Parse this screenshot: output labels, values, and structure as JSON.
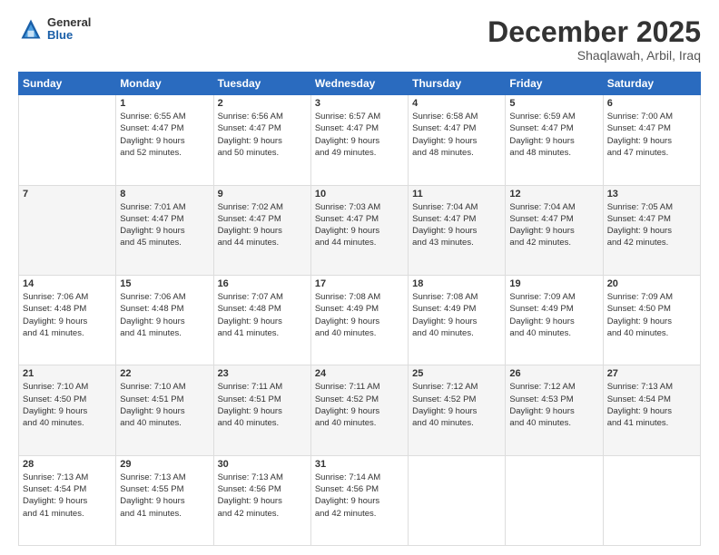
{
  "header": {
    "logo_general": "General",
    "logo_blue": "Blue",
    "month": "December 2025",
    "location": "Shaqlawah, Arbil, Iraq"
  },
  "days_of_week": [
    "Sunday",
    "Monday",
    "Tuesday",
    "Wednesday",
    "Thursday",
    "Friday",
    "Saturday"
  ],
  "weeks": [
    [
      {
        "day": "",
        "info": ""
      },
      {
        "day": "1",
        "info": "Sunrise: 6:55 AM\nSunset: 4:47 PM\nDaylight: 9 hours\nand 52 minutes."
      },
      {
        "day": "2",
        "info": "Sunrise: 6:56 AM\nSunset: 4:47 PM\nDaylight: 9 hours\nand 50 minutes."
      },
      {
        "day": "3",
        "info": "Sunrise: 6:57 AM\nSunset: 4:47 PM\nDaylight: 9 hours\nand 49 minutes."
      },
      {
        "day": "4",
        "info": "Sunrise: 6:58 AM\nSunset: 4:47 PM\nDaylight: 9 hours\nand 48 minutes."
      },
      {
        "day": "5",
        "info": "Sunrise: 6:59 AM\nSunset: 4:47 PM\nDaylight: 9 hours\nand 48 minutes."
      },
      {
        "day": "6",
        "info": "Sunrise: 7:00 AM\nSunset: 4:47 PM\nDaylight: 9 hours\nand 47 minutes."
      }
    ],
    [
      {
        "day": "7",
        "info": ""
      },
      {
        "day": "8",
        "info": "Sunrise: 7:01 AM\nSunset: 4:47 PM\nDaylight: 9 hours\nand 45 minutes."
      },
      {
        "day": "9",
        "info": "Sunrise: 7:02 AM\nSunset: 4:47 PM\nDaylight: 9 hours\nand 44 minutes."
      },
      {
        "day": "10",
        "info": "Sunrise: 7:03 AM\nSunset: 4:47 PM\nDaylight: 9 hours\nand 44 minutes."
      },
      {
        "day": "11",
        "info": "Sunrise: 7:04 AM\nSunset: 4:47 PM\nDaylight: 9 hours\nand 43 minutes."
      },
      {
        "day": "12",
        "info": "Sunrise: 7:04 AM\nSunset: 4:47 PM\nDaylight: 9 hours\nand 42 minutes."
      },
      {
        "day": "13",
        "info": "Sunrise: 7:05 AM\nSunset: 4:47 PM\nDaylight: 9 hours\nand 42 minutes."
      }
    ],
    [
      {
        "day": "14",
        "info": "Sunrise: 7:06 AM\nSunset: 4:48 PM\nDaylight: 9 hours\nand 41 minutes."
      },
      {
        "day": "15",
        "info": "Sunrise: 7:06 AM\nSunset: 4:48 PM\nDaylight: 9 hours\nand 41 minutes."
      },
      {
        "day": "16",
        "info": "Sunrise: 7:07 AM\nSunset: 4:48 PM\nDaylight: 9 hours\nand 41 minutes."
      },
      {
        "day": "17",
        "info": "Sunrise: 7:08 AM\nSunset: 4:49 PM\nDaylight: 9 hours\nand 40 minutes."
      },
      {
        "day": "18",
        "info": "Sunrise: 7:08 AM\nSunset: 4:49 PM\nDaylight: 9 hours\nand 40 minutes."
      },
      {
        "day": "19",
        "info": "Sunrise: 7:09 AM\nSunset: 4:49 PM\nDaylight: 9 hours\nand 40 minutes."
      },
      {
        "day": "20",
        "info": "Sunrise: 7:09 AM\nSunset: 4:50 PM\nDaylight: 9 hours\nand 40 minutes."
      }
    ],
    [
      {
        "day": "21",
        "info": "Sunrise: 7:10 AM\nSunset: 4:50 PM\nDaylight: 9 hours\nand 40 minutes."
      },
      {
        "day": "22",
        "info": "Sunrise: 7:10 AM\nSunset: 4:51 PM\nDaylight: 9 hours\nand 40 minutes."
      },
      {
        "day": "23",
        "info": "Sunrise: 7:11 AM\nSunset: 4:51 PM\nDaylight: 9 hours\nand 40 minutes."
      },
      {
        "day": "24",
        "info": "Sunrise: 7:11 AM\nSunset: 4:52 PM\nDaylight: 9 hours\nand 40 minutes."
      },
      {
        "day": "25",
        "info": "Sunrise: 7:12 AM\nSunset: 4:52 PM\nDaylight: 9 hours\nand 40 minutes."
      },
      {
        "day": "26",
        "info": "Sunrise: 7:12 AM\nSunset: 4:53 PM\nDaylight: 9 hours\nand 40 minutes."
      },
      {
        "day": "27",
        "info": "Sunrise: 7:13 AM\nSunset: 4:54 PM\nDaylight: 9 hours\nand 41 minutes."
      }
    ],
    [
      {
        "day": "28",
        "info": "Sunrise: 7:13 AM\nSunset: 4:54 PM\nDaylight: 9 hours\nand 41 minutes."
      },
      {
        "day": "29",
        "info": "Sunrise: 7:13 AM\nSunset: 4:55 PM\nDaylight: 9 hours\nand 41 minutes."
      },
      {
        "day": "30",
        "info": "Sunrise: 7:13 AM\nSunset: 4:56 PM\nDaylight: 9 hours\nand 42 minutes."
      },
      {
        "day": "31",
        "info": "Sunrise: 7:14 AM\nSunset: 4:56 PM\nDaylight: 9 hours\nand 42 minutes."
      },
      {
        "day": "",
        "info": ""
      },
      {
        "day": "",
        "info": ""
      },
      {
        "day": "",
        "info": ""
      }
    ]
  ]
}
